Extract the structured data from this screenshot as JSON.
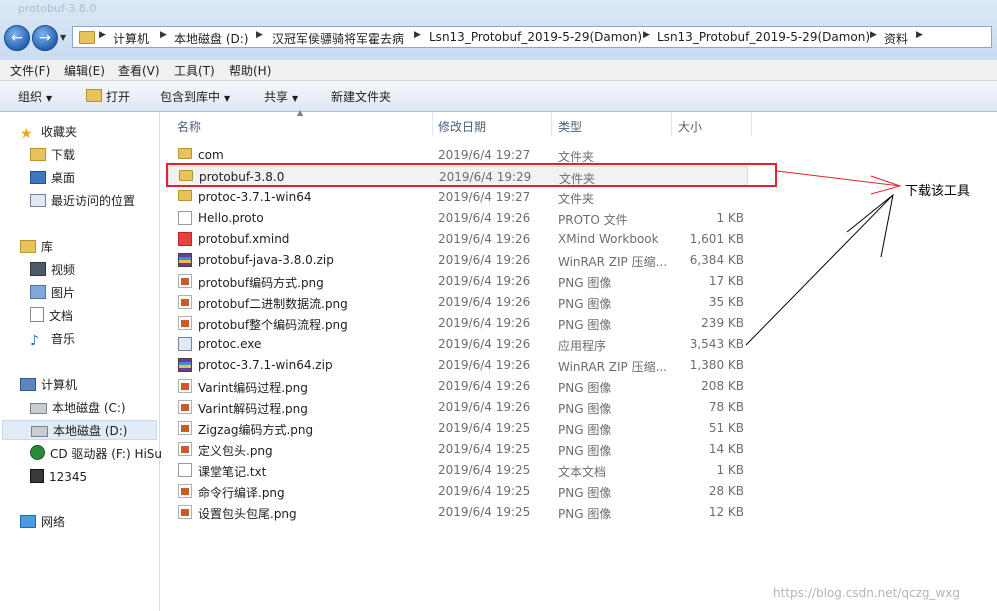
{
  "window": {
    "title": "protobuf-3.8.0"
  },
  "breadcrumb": [
    "计算机",
    "本地磁盘 (D:)",
    "汉冠军侯骠骑将军霍去病",
    "Lsn13_Protobuf_2019-5-29(Damon)",
    "Lsn13_Protobuf_2019-5-29(Damon)",
    "资料"
  ],
  "menu": [
    "文件(F)",
    "编辑(E)",
    "查看(V)",
    "工具(T)",
    "帮助(H)"
  ],
  "toolbar": {
    "organize": "组织",
    "open": "打开",
    "include": "包含到库中",
    "share": "共享",
    "new_folder": "新建文件夹"
  },
  "nav": {
    "favorites": "收藏夹",
    "fav_items": [
      "下载",
      "桌面",
      "最近访问的位置"
    ],
    "libraries": "库",
    "lib_items": [
      "视频",
      "图片",
      "文档",
      "音乐"
    ],
    "computer": "计算机",
    "comp_items": [
      "本地磁盘 (C:)",
      "本地磁盘 (D:)",
      "CD 驱动器 (F:) HiSu",
      "12345"
    ],
    "network": "网络"
  },
  "columns": {
    "name": "名称",
    "date": "修改日期",
    "type": "类型",
    "size": "大小"
  },
  "files": [
    {
      "name": "com",
      "date": "2019/6/4 19:27",
      "type": "文件夹",
      "size": "",
      "icon": "folder"
    },
    {
      "name": "protobuf-3.8.0",
      "date": "2019/6/4 19:29",
      "type": "文件夹",
      "size": "",
      "icon": "folder"
    },
    {
      "name": "protoc-3.7.1-win64",
      "date": "2019/6/4 19:27",
      "type": "文件夹",
      "size": "",
      "icon": "folder"
    },
    {
      "name": "Hello.proto",
      "date": "2019/6/4 19:26",
      "type": "PROTO 文件",
      "size": "1 KB",
      "icon": "doc"
    },
    {
      "name": "protobuf.xmind",
      "date": "2019/6/4 19:26",
      "type": "XMind Workbook",
      "size": "1,601 KB",
      "icon": "xmind"
    },
    {
      "name": "protobuf-java-3.8.0.zip",
      "date": "2019/6/4 19:26",
      "type": "WinRAR ZIP 压缩...",
      "size": "6,384 KB",
      "icon": "zip"
    },
    {
      "name": "protobuf编码方式.png",
      "date": "2019/6/4 19:26",
      "type": "PNG 图像",
      "size": "17 KB",
      "icon": "png"
    },
    {
      "name": "protobuf二进制数据流.png",
      "date": "2019/6/4 19:26",
      "type": "PNG 图像",
      "size": "35 KB",
      "icon": "png"
    },
    {
      "name": "protobuf整个编码流程.png",
      "date": "2019/6/4 19:26",
      "type": "PNG 图像",
      "size": "239 KB",
      "icon": "png"
    },
    {
      "name": "protoc.exe",
      "date": "2019/6/4 19:26",
      "type": "应用程序",
      "size": "3,543 KB",
      "icon": "exe"
    },
    {
      "name": "protoc-3.7.1-win64.zip",
      "date": "2019/6/4 19:26",
      "type": "WinRAR ZIP 压缩...",
      "size": "1,380 KB",
      "icon": "zip"
    },
    {
      "name": "Varint编码过程.png",
      "date": "2019/6/4 19:26",
      "type": "PNG 图像",
      "size": "208 KB",
      "icon": "png"
    },
    {
      "name": "Varint解码过程.png",
      "date": "2019/6/4 19:26",
      "type": "PNG 图像",
      "size": "78 KB",
      "icon": "png"
    },
    {
      "name": "Zigzag编码方式.png",
      "date": "2019/6/4 19:25",
      "type": "PNG 图像",
      "size": "51 KB",
      "icon": "png"
    },
    {
      "name": "定义包头.png",
      "date": "2019/6/4 19:25",
      "type": "PNG 图像",
      "size": "14 KB",
      "icon": "png"
    },
    {
      "name": "课堂笔记.txt",
      "date": "2019/6/4 19:25",
      "type": "文本文档",
      "size": "1 KB",
      "icon": "txt"
    },
    {
      "name": "命令行编译.png",
      "date": "2019/6/4 19:25",
      "type": "PNG 图像",
      "size": "28 KB",
      "icon": "png"
    },
    {
      "name": "设置包头包尾.png",
      "date": "2019/6/4 19:25",
      "type": "PNG 图像",
      "size": "12 KB",
      "icon": "png"
    }
  ],
  "annotation": {
    "text": "下载该工具",
    "color": "#e1232b"
  },
  "watermark": "https://blog.csdn.net/qczg_wxg"
}
